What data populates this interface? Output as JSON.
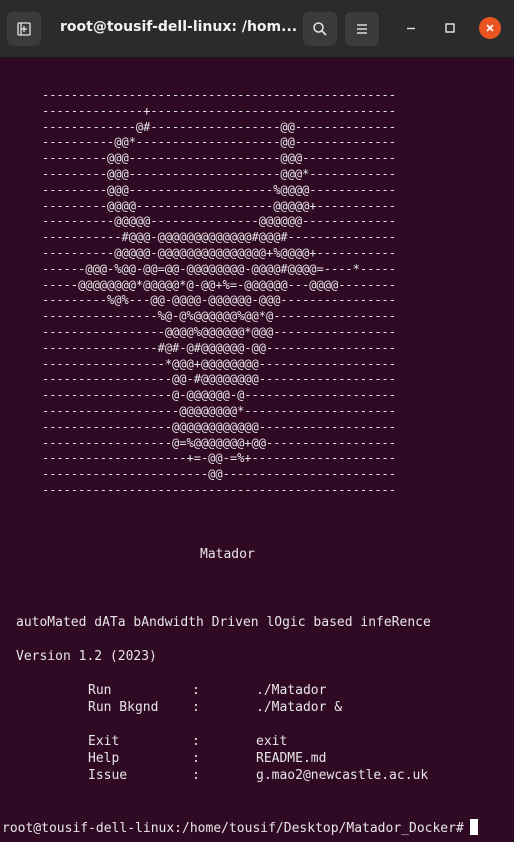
{
  "window": {
    "title": "root@tousif-dell-linux: /hom...",
    "icons": {
      "new_tab": "new-tab-icon",
      "search": "search-icon",
      "menu": "hamburger-menu-icon",
      "minimize": "minimize-icon",
      "maximize": "maximize-icon",
      "close": "close-icon"
    },
    "close_color": "#e95420",
    "terminal_bg": "#300a24"
  },
  "terminal": {
    "ascii_art": [
      "-------------------------------------------------",
      "--------------+----------------------------------",
      "-------------@#------------------@@--------------",
      "----------@@*--------------------@@--------------",
      "---------@@@---------------------@@@-------------",
      "---------@@@---------------------@@@*------------",
      "---------@@@--------------------%@@@@------------",
      "---------@@@@-------------------@@@@@+-----------",
      "----------@@@@@---------------@@@@@@-------------",
      "-----------#@@@-@@@@@@@@@@@@@#@@@#---------------",
      "----------@@@@@-@@@@@@@@@@@@@@@+%@@@@+-----------",
      "------@@@-%@@-@@=@@-@@@@@@@@-@@@@#@@@@=----*-----",
      "-----@@@@@@@@*@@@@@*@-@@+%=-@@@@@@---@@@@--------",
      "---------%@%---@@-@@@@-@@@@@@-@@@----------------",
      "----------------%@-@%@@@@@@%@@*@-----------------",
      "-----------------@@@@%@@@@@@*@@@-----------------",
      "----------------#@#-@#@@@@@@-@@------------------",
      "-----------------*@@@+@@@@@@@@-------------------",
      "------------------@@-#@@@@@@@@-------------------",
      "------------------@-@@@@@@-@---------------------",
      "-------------------@@@@@@@@*---------------------",
      "------------------@@@@@@@@@@@@-------------------",
      "------------------@=%@@@@@@@+@@------------------",
      "--------------------+=-@@-=%+--------------------",
      "-----------------------@@------------------------",
      "-------------------------------------------------"
    ],
    "app_name": "Matador",
    "tagline": "autoMated dATa bAndwidth Driven lOgic based infeRence",
    "version": "Version 1.2 (2023)",
    "menu": [
      {
        "label": "Run",
        "sep": ":",
        "value": "./Matador"
      },
      {
        "label": "Run Bkgnd",
        "sep": ":",
        "value": "./Matador &"
      },
      {
        "label": "Exit",
        "sep": ":",
        "value": "exit"
      },
      {
        "label": "Help",
        "sep": ":",
        "value": "README.md"
      },
      {
        "label": "Issue",
        "sep": ":",
        "value": "g.mao2@newcastle.ac.uk"
      }
    ],
    "prompt": "root@tousif-dell-linux:/home/tousif/Desktop/Matador_Docker#"
  }
}
